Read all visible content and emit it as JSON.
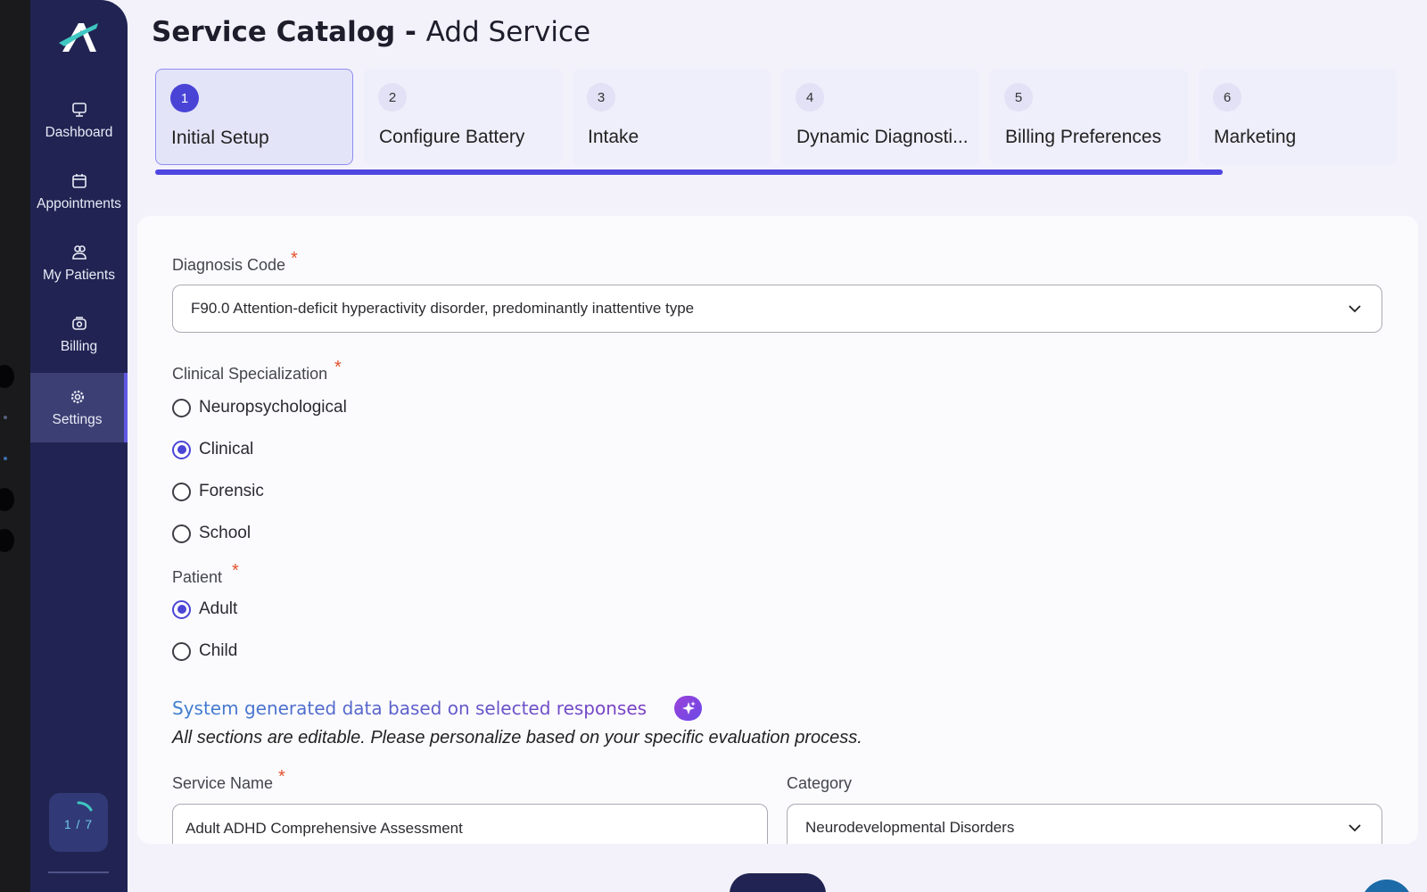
{
  "sidebar": {
    "logo": "brand-logo",
    "items": [
      {
        "label": "Dashboard",
        "icon": "monitor-icon"
      },
      {
        "label": "Appointments",
        "icon": "calendar-icon"
      },
      {
        "label": "My Patients",
        "icon": "users-icon"
      },
      {
        "label": "Billing",
        "icon": "billing-icon"
      },
      {
        "label": "Settings",
        "icon": "gear-icon",
        "active": true
      }
    ],
    "progress": "1 / 7"
  },
  "header": {
    "title_main": "Service Catalog",
    "title_sep": "-",
    "title_sub": "Add Service"
  },
  "steps": [
    {
      "num": "1",
      "label": "Initial Setup",
      "active": true
    },
    {
      "num": "2",
      "label": "Configure Battery"
    },
    {
      "num": "3",
      "label": "Intake"
    },
    {
      "num": "4",
      "label": "Dynamic Diagnosti..."
    },
    {
      "num": "5",
      "label": "Billing Preferences"
    },
    {
      "num": "6",
      "label": "Marketing"
    }
  ],
  "form": {
    "diagnosis_code": {
      "label": "Diagnosis Code",
      "required": "*",
      "value": "F90.0 Attention-deficit hyperactivity disorder, predominantly inattentive type"
    },
    "clinical_specialization": {
      "label": "Clinical Specialization",
      "required": "*",
      "options": [
        "Neuropsychological",
        "Clinical",
        "Forensic",
        "School"
      ],
      "selected": "Clinical"
    },
    "patient": {
      "label": "Patient",
      "required": "*",
      "options": [
        "Adult",
        "Child"
      ],
      "selected": "Adult"
    },
    "system_generated": {
      "heading": "System generated data based on selected responses",
      "note": "All sections are editable. Please personalize based on your specific evaluation process."
    },
    "service_name": {
      "label": "Service Name",
      "required": "*",
      "value": "Adult ADHD Comprehensive Assessment"
    },
    "category": {
      "label": "Category",
      "value": "Neurodevelopmental Disorders"
    }
  },
  "colors": {
    "sidebar_bg": "#212452",
    "accent": "#4f47e0",
    "required": "#e4512b"
  }
}
